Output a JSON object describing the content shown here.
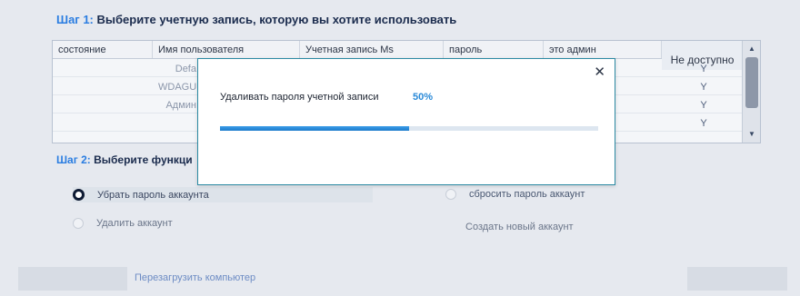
{
  "step1": {
    "prefix": "Шаг 1:",
    "text": " Выберите учетную запись, которую вы хотите использовать"
  },
  "table": {
    "columns": [
      "состояние",
      "Имя пользователя",
      "Учетная запись Ms",
      "пароль",
      "это админ",
      "Не доступно"
    ],
    "rows": [
      {
        "status": "",
        "user": "Defa",
        "na": "Y"
      },
      {
        "status": "",
        "user": "WDAGU",
        "na": "Y"
      },
      {
        "status": "",
        "user": "Админ",
        "na": "Y"
      },
      {
        "status": "",
        "user": "",
        "na": "Y"
      }
    ]
  },
  "step2": {
    "prefix": "Шаг 2:",
    "text": " Выберите функци"
  },
  "options": {
    "remove_password": "Убрать пароль аккаунта",
    "reset_password": "сбросить пароль аккаунт",
    "delete_account": "Удалить аккаунт",
    "create_account": "Создать новый аккаунт"
  },
  "footer": {
    "reboot": "Перезагрузить компьютер"
  },
  "dialog": {
    "close": "✕",
    "message": "Удаливать пароля учетной записи",
    "percent_label": "50%",
    "progress": 0.5
  },
  "colors": {
    "accent": "#2a7de1",
    "progress": "#2a8ad8",
    "dialog_border": "#2b8aa3"
  }
}
